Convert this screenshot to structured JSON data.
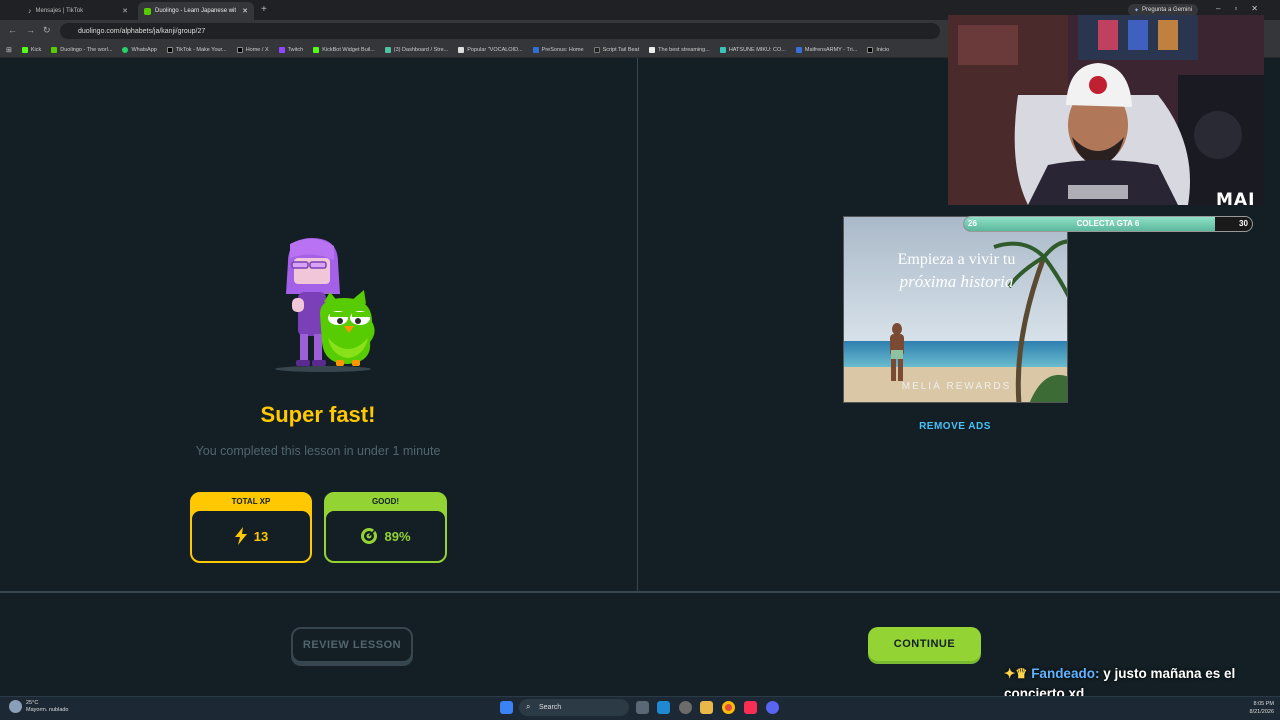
{
  "browser": {
    "tabs": [
      {
        "title": "Mensajes | TikTok",
        "active": false
      },
      {
        "title": "Duolingo - Learn Japanese wit",
        "active": true
      }
    ],
    "url": "duolingo.com/alphabets/ja/kanji/group/27",
    "gemini_label": "Pregunta a Gemini",
    "bookmarks": [
      "Kick",
      "Duolingo - The worl...",
      "WhatsApp",
      "TikTok - Make Your...",
      "Home / X",
      "Twitch",
      "KickBot Widget Buil...",
      "(3) Dashboard / Stre...",
      "Popular \"VOCALOID...",
      "PreSonus: Home",
      "Script Tail Beat",
      "The best streaming...",
      "HATSUNE MIKU: CO...",
      "MaifrensARMY - Tri...",
      "Inicio"
    ]
  },
  "lesson": {
    "title": "Super fast!",
    "subtitle": "You completed this lesson in under 1 minute",
    "xp_label": "TOTAL XP",
    "xp_value": "13",
    "accuracy_label": "GOOD!",
    "accuracy_value": "89%",
    "review_button": "REVIEW LESSON",
    "continue_button": "CONTINUE"
  },
  "ad": {
    "line1": "Empieza a vivir tu",
    "line2": "próxima historia",
    "brand": "MELIÁ REWARDS",
    "remove_ads": "REMOVE ADS"
  },
  "overlay": {
    "cam_label": "MAI",
    "goal_label": "COLECTA GTA 6",
    "goal_current": "26",
    "goal_target": "30",
    "goal_progress": 0.87,
    "chat_user": "Fandeado:",
    "chat_message": "y justo mañana es el concierto xd"
  },
  "taskbar": {
    "weather_temp": "25°C",
    "weather_desc": "Mayorm. nublado",
    "search_placeholder": "Search",
    "time": "8:05 PM",
    "date": "8/21/2026"
  },
  "colors": {
    "background": "#131f24",
    "gold": "#ffc800",
    "green": "#93d333",
    "blue": "#49c0f8"
  }
}
